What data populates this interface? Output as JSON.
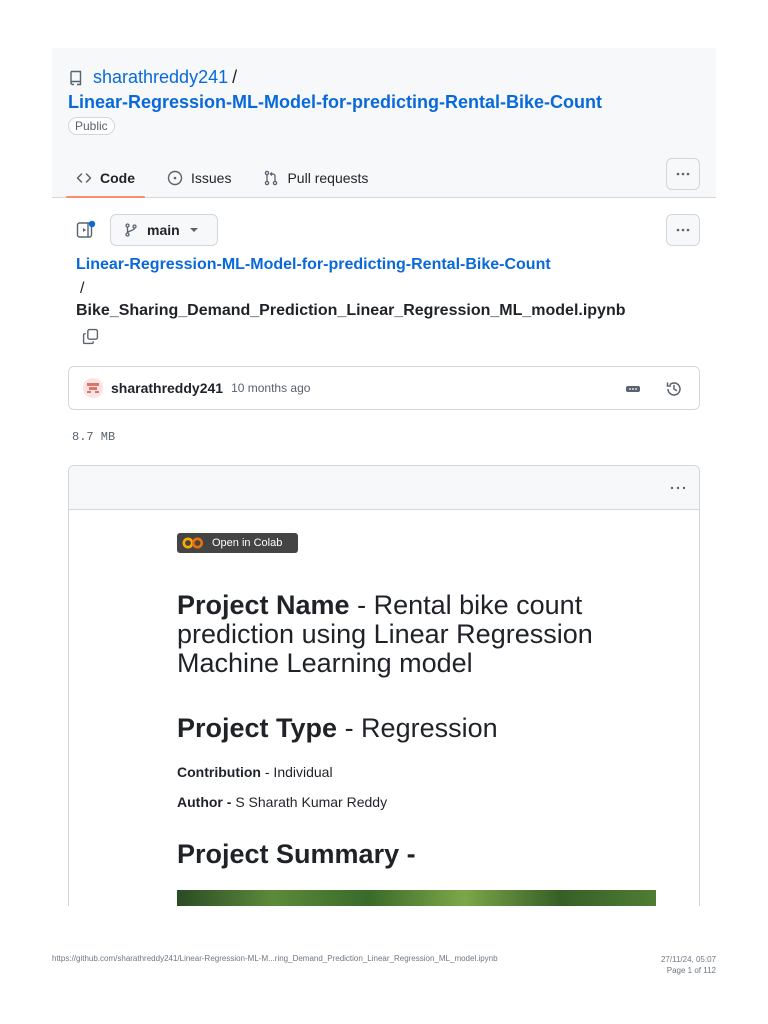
{
  "repo": {
    "owner": "sharathreddy241",
    "separator": "/",
    "name": "Linear-Regression-ML-Model-for-predicting-Rental-Bike-Count",
    "visibility": "Public"
  },
  "nav": {
    "tabs": [
      {
        "label": "Code",
        "icon": "code-icon"
      },
      {
        "label": "Issues",
        "icon": "issue-icon"
      },
      {
        "label": "Pull requests",
        "icon": "pull-request-icon"
      }
    ]
  },
  "branch": {
    "name": "main"
  },
  "breadcrumb": {
    "repo": "Linear-Regression-ML-Model-for-predicting-Rental-Bike-Count",
    "separator": "/",
    "file": "Bike_Sharing_Demand_Prediction_Linear_Regression_ML_model.ipynb"
  },
  "commit": {
    "user": "sharathreddy241",
    "time": "10 months ago"
  },
  "file_size": "8.7 MB",
  "notebook": {
    "colab_badge": "Open in Colab",
    "project_name_label": "Project Name",
    "project_name_value": " - Rental bike count prediction using Linear Regression Machine Learning model",
    "project_type_label": "Project Type",
    "project_type_value": " - Regression",
    "contribution_label": "Contribution",
    "contribution_value": " - Individual",
    "author_label": "Author -",
    "author_value": " S Sharath Kumar Reddy",
    "summary_heading": "Project Summary -"
  },
  "footer": {
    "url": "https://github.com/sharathreddy241/Linear-Regression-ML-M...ring_Demand_Prediction_Linear_Regression_ML_model.ipynb",
    "datetime": "27/11/24, 05:07",
    "page": "Page 1 of 112"
  },
  "colors": {
    "link": "#0969da",
    "selected_tab_underline": "#fd8c73",
    "header_bg": "#f6f8fa"
  }
}
